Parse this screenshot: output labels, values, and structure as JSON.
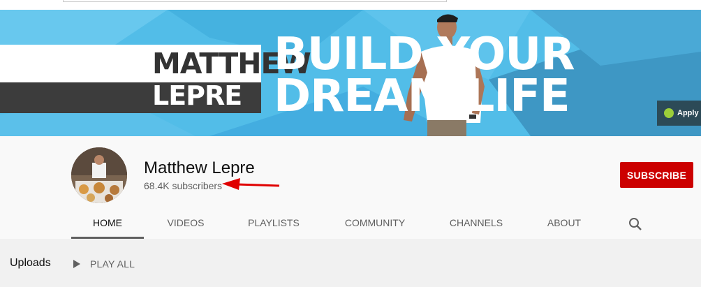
{
  "banner": {
    "name_line_1": "MATTHEW",
    "name_line_2": "LEPRE",
    "slogan_line_1": "BUILD YOUR",
    "slogan_line_2": "DREAM LIFE",
    "apply_chip_label": "Apply"
  },
  "channel": {
    "name": "Matthew Lepre",
    "subscribers": "68.4K subscribers",
    "subscribe_label": "SUBSCRIBE"
  },
  "tabs": [
    {
      "label": "HOME",
      "active": true
    },
    {
      "label": "VIDEOS",
      "active": false
    },
    {
      "label": "PLAYLISTS",
      "active": false
    },
    {
      "label": "COMMUNITY",
      "active": false
    },
    {
      "label": "CHANNELS",
      "active": false
    },
    {
      "label": "ABOUT",
      "active": false
    }
  ],
  "tab_search_icon": "search-icon",
  "uploads": {
    "title": "Uploads",
    "play_all_label": "PLAY ALL",
    "play_icon": "play-icon"
  },
  "colors": {
    "banner_blue": "#52bde8",
    "subscribe_red": "#cc0000",
    "annotation_arrow": "#e00000"
  }
}
